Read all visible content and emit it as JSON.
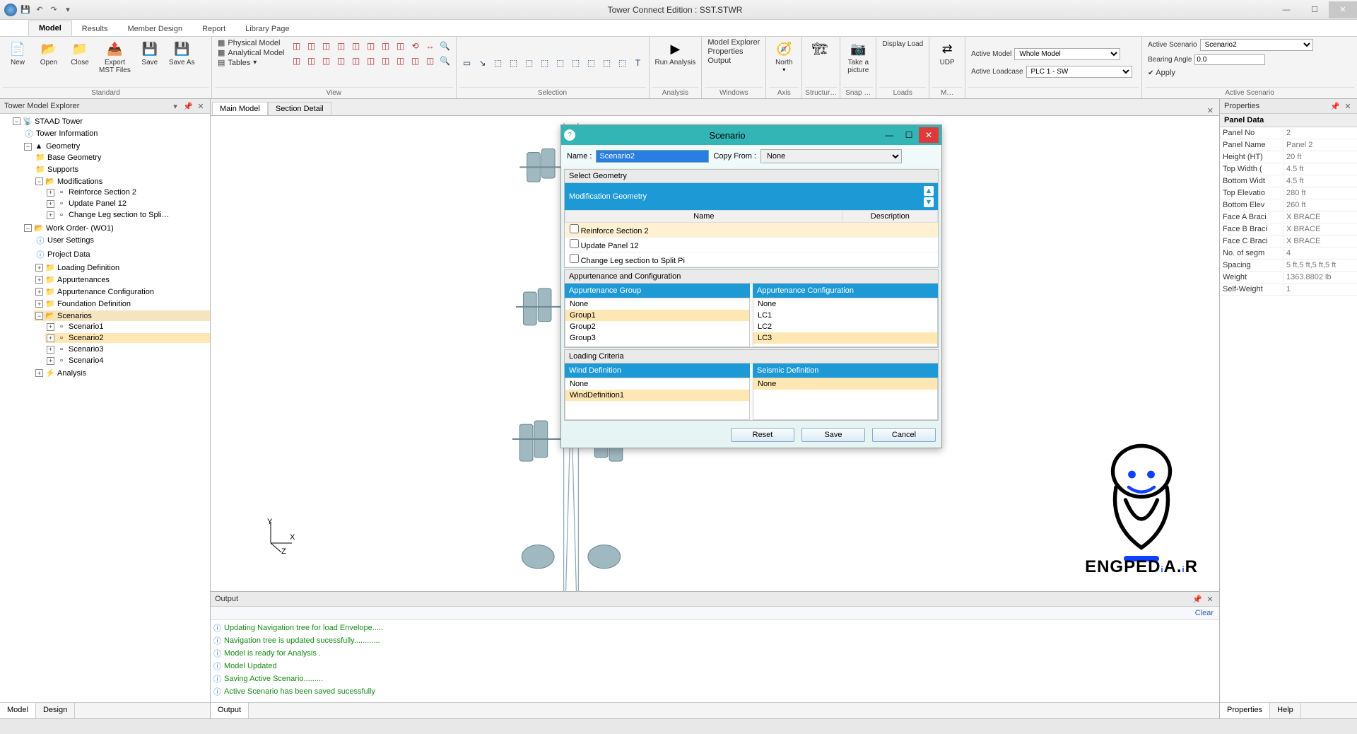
{
  "titlebar": {
    "title": "Tower Connect Edition : SST.STWR"
  },
  "ribbonTabs": [
    "Model",
    "Results",
    "Member Design",
    "Report",
    "Library Page"
  ],
  "ribbonTabActive": 0,
  "ribbon": {
    "standard": {
      "label": "Standard",
      "buttons": {
        "new": "New",
        "open": "Open",
        "close": "Close",
        "export": "Export\nMST Files",
        "save": "Save",
        "saveas": "Save As"
      }
    },
    "view": {
      "label": "View",
      "physical": "Physical Model",
      "analytical": "Analytical Model",
      "tables": "Tables"
    },
    "selection": {
      "label": "Selection"
    },
    "analysis": {
      "label": "Analysis",
      "run": "Run Analysis"
    },
    "windows": {
      "label": "Windows",
      "me": "Model Explorer",
      "props": "Properties",
      "out": "Output"
    },
    "axis": {
      "label": "Axis",
      "north": "North"
    },
    "structure": {
      "label": "Structur…"
    },
    "snap": {
      "label": "Snap …",
      "pic": "Take a\npicture"
    },
    "loads": {
      "label": "Loads",
      "display": "Display Load"
    },
    "misc": {
      "label": "M…",
      "udp": "UDP"
    },
    "context": {
      "activeModelLabel": "Active Model",
      "activeModelValue": "Whole Model",
      "activeLoadcaseLabel": "Active Loadcase",
      "activeLoadcaseValue": "PLC 1 - SW"
    },
    "scenario": {
      "label": "Active Scenario",
      "activeScenarioLabel": "Active Scenario",
      "activeScenarioValue": "Scenario2",
      "bearingLabel": "Bearing Angle",
      "bearingValue": "0.0",
      "apply": "Apply"
    }
  },
  "explorer": {
    "title": "Tower Model Explorer",
    "root": "STAAD Tower",
    "nodes": {
      "towerInfo": "Tower Information",
      "geometry": "Geometry",
      "baseGeo": "Base Geometry",
      "supports": "Supports",
      "mods": "Modifications",
      "reinforce": "Reinforce Section 2",
      "updatePanel": "Update Panel 12",
      "changeLeg": "Change Leg section to Spli…",
      "wo": "Work Order- (WO1)",
      "userSettings": "User Settings",
      "projectData": "Project Data",
      "loadingDef": "Loading Definition",
      "appurt": "Appurtenances",
      "appurtConfig": "Appurtenance Configuration",
      "foundation": "Foundation Definition",
      "scenarios": "Scenarios",
      "s1": "Scenario1",
      "s2": "Scenario2",
      "s3": "Scenario3",
      "s4": "Scenario4",
      "analysis": "Analysis"
    },
    "bottomTabs": {
      "model": "Model",
      "design": "Design"
    }
  },
  "docTabs": {
    "main": "Main Model",
    "section": "Section Detail"
  },
  "dialog": {
    "title": "Scenario",
    "nameLabel": "Name :",
    "nameValue": "Scenario2",
    "copyLabel": "Copy From :",
    "copyValue": "None",
    "selectGeo": "Select Geometry",
    "modGeo": "Modification Geometry",
    "th": {
      "name": "Name",
      "desc": "Description"
    },
    "rows": [
      "Reinforce Section 2",
      "Update Panel 12",
      "Change Leg section to Split Pi"
    ],
    "appConfigHd": "Appurtenance and Configuration",
    "appGroup": "Appurtenance Group",
    "appGroupItems": [
      "None",
      "Group1",
      "Group2",
      "Group3"
    ],
    "appConf": "Appurtenance Configuration",
    "appConfItems": [
      "None",
      "LC1",
      "LC2",
      "LC3"
    ],
    "loadingHd": "Loading Criteria",
    "windHd": "Wind Definition",
    "windItems": [
      "None",
      "WindDefinition1"
    ],
    "seisHd": "Seismic Definition",
    "seisItems": [
      "None"
    ],
    "btns": {
      "reset": "Reset",
      "save": "Save",
      "cancel": "Cancel"
    }
  },
  "output": {
    "title": "Output",
    "clear": "Clear",
    "lines": [
      "Updating Navigation tree for load Envelope.....",
      "Navigation tree is updated sucessfully............",
      "Model is ready for Analysis .",
      "Model Updated",
      "Saving Active Scenario.........",
      "Active Scenario has been saved sucessfully"
    ],
    "tab": "Output"
  },
  "props": {
    "title": "Properties",
    "group": "Panel Data",
    "rows": [
      {
        "k": "Panel No",
        "v": "2"
      },
      {
        "k": "Panel Name",
        "v": "Panel 2"
      },
      {
        "k": "Height (HT)",
        "v": "20 ft"
      },
      {
        "k": "Top Width (",
        "v": "4.5 ft"
      },
      {
        "k": "Bottom Widt",
        "v": "4.5 ft"
      },
      {
        "k": "Top Elevatio",
        "v": "280 ft"
      },
      {
        "k": "Bottom Elev",
        "v": "260 ft"
      },
      {
        "k": "Face A Braci",
        "v": "X BRACE"
      },
      {
        "k": "Face B Braci",
        "v": "X BRACE"
      },
      {
        "k": "Face C Braci",
        "v": "X BRACE"
      },
      {
        "k": "No. of segm",
        "v": "4"
      },
      {
        "k": "Spacing",
        "v": "5 ft,5 ft,5 ft,5 ft"
      },
      {
        "k": "Weight",
        "v": "1363.8802 lb"
      },
      {
        "k": "Self-Weight",
        "v": "1"
      }
    ],
    "bottomTabs": {
      "properties": "Properties",
      "help": "Help"
    }
  },
  "brand": "ENGPEDiA.iR"
}
